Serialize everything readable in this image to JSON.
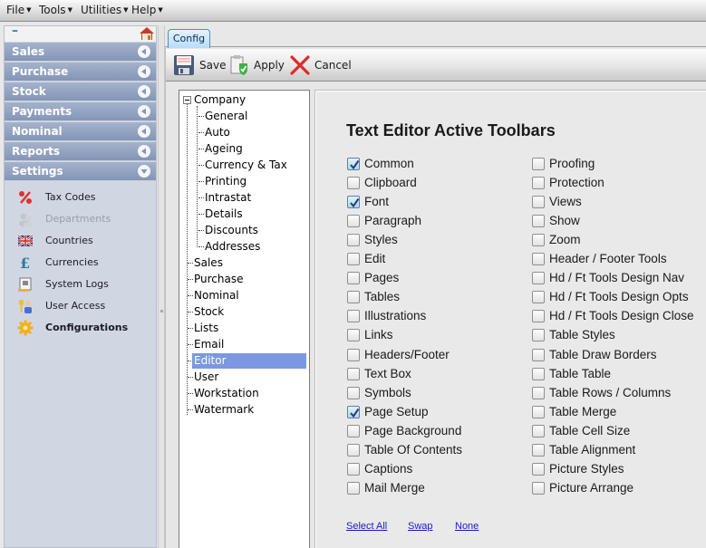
{
  "menu": [
    {
      "label": "File"
    },
    {
      "label": "Tools"
    },
    {
      "label": "Utilities"
    },
    {
      "label": "Help"
    }
  ],
  "nav": {
    "collapse_symbol": "–",
    "home_icon": "home-icon",
    "sections": [
      {
        "label": "Sales",
        "state": "collapsed"
      },
      {
        "label": "Purchase",
        "state": "collapsed"
      },
      {
        "label": "Stock",
        "state": "collapsed"
      },
      {
        "label": "Payments",
        "state": "collapsed"
      },
      {
        "label": "Nominal",
        "state": "collapsed"
      },
      {
        "label": "Reports",
        "state": "collapsed"
      },
      {
        "label": "Settings",
        "state": "expanded"
      }
    ],
    "settings_items": [
      {
        "label": "Tax Codes",
        "icon": "percent-icon"
      },
      {
        "label": "Departments",
        "icon": "users-icon",
        "disabled": true
      },
      {
        "label": "Countries",
        "icon": "uk-flag-icon"
      },
      {
        "label": "Currencies",
        "icon": "pound-icon"
      },
      {
        "label": "System Logs",
        "icon": "log-icon"
      },
      {
        "label": "User Access",
        "icon": "user-access-icon"
      },
      {
        "label": "Configurations",
        "icon": "gear-icon",
        "active": true
      }
    ]
  },
  "tab": {
    "label": "Config"
  },
  "toolbar": {
    "save_label": "Save",
    "apply_label": "Apply",
    "cancel_label": "Cancel"
  },
  "tree": {
    "root": "Company",
    "company_children": [
      "General",
      "Auto",
      "Ageing",
      "Currency & Tax",
      "Printing",
      "Intrastat",
      "Details",
      "Discounts",
      "Addresses"
    ],
    "top_level": [
      "Sales",
      "Purchase",
      "Nominal",
      "Stock",
      "Lists",
      "Email",
      "Editor",
      "User",
      "Workstation",
      "Watermark"
    ],
    "selected": "Editor"
  },
  "panel": {
    "title": "Text Editor Active Toolbars",
    "left_column": [
      {
        "label": "Common",
        "checked": true
      },
      {
        "label": "Clipboard",
        "checked": false
      },
      {
        "label": "Font",
        "checked": true
      },
      {
        "label": "Paragraph",
        "checked": false
      },
      {
        "label": "Styles",
        "checked": false
      },
      {
        "label": "Edit",
        "checked": false
      },
      {
        "label": "Pages",
        "checked": false
      },
      {
        "label": "Tables",
        "checked": false
      },
      {
        "label": "Illustrations",
        "checked": false
      },
      {
        "label": "Links",
        "checked": false
      },
      {
        "label": "Headers/Footer",
        "checked": false
      },
      {
        "label": "Text Box",
        "checked": false
      },
      {
        "label": "Symbols",
        "checked": false
      },
      {
        "label": "Page Setup",
        "checked": true
      },
      {
        "label": "Page Background",
        "checked": false
      },
      {
        "label": "Table Of Contents",
        "checked": false
      },
      {
        "label": "Captions",
        "checked": false
      },
      {
        "label": "Mail Merge",
        "checked": false
      }
    ],
    "right_column": [
      {
        "label": "Proofing",
        "checked": false
      },
      {
        "label": "Protection",
        "checked": false
      },
      {
        "label": "Views",
        "checked": false
      },
      {
        "label": "Show",
        "checked": false
      },
      {
        "label": "Zoom",
        "checked": false
      },
      {
        "label": "Header / Footer Tools",
        "checked": false
      },
      {
        "label": "Hd / Ft Tools Design Nav",
        "checked": false
      },
      {
        "label": "Hd / Ft Tools Design Opts",
        "checked": false
      },
      {
        "label": "Hd / Ft Tools Design Close",
        "checked": false
      },
      {
        "label": "Table Styles",
        "checked": false
      },
      {
        "label": "Table Draw Borders",
        "checked": false
      },
      {
        "label": "Table Table",
        "checked": false
      },
      {
        "label": "Table Rows / Columns",
        "checked": false
      },
      {
        "label": "Table Merge",
        "checked": false
      },
      {
        "label": "Table Cell Size",
        "checked": false
      },
      {
        "label": "Table Alignment",
        "checked": false
      },
      {
        "label": "Picture Styles",
        "checked": false
      },
      {
        "label": "Picture Arrange",
        "checked": false
      }
    ],
    "links": {
      "select_all": "Select All",
      "swap": "Swap",
      "none": "None"
    }
  }
}
